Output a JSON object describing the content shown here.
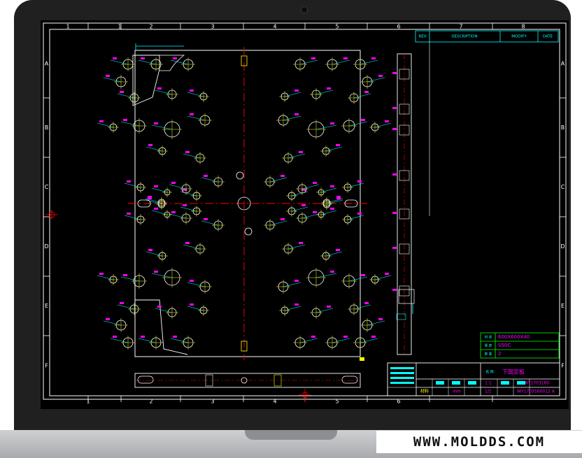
{
  "colors": {
    "screen": "#000000",
    "line": "#ffffff",
    "cyan": "#00ffff",
    "magenta": "#ff00ff",
    "yellow": "#ffff00",
    "red": "#ff0000",
    "green": "#00ff00",
    "laptop_body": "#202020",
    "laptop_base": "#bdbec0"
  },
  "icons": {
    "webcam": "webcam-icon",
    "crosshair": "crosshair-icon"
  },
  "brand": {
    "url": "WWW.MOLDDS.COM"
  },
  "drawing": {
    "column_numbers": [
      "1",
      "1",
      "2",
      "3",
      "4",
      "5",
      "6",
      "7",
      "8"
    ],
    "bottom_column_numbers": [
      "1",
      "2",
      "3",
      "4",
      "5",
      "6"
    ],
    "row_letters": [
      "A",
      "B",
      "C",
      "D",
      "E",
      "F"
    ],
    "revision_headers": [
      "REV",
      "DESCRIPTION",
      "MODIFY",
      "DATE"
    ],
    "specs": [
      "600X600X40",
      "S50C",
      "2"
    ],
    "title_block": {
      "name": "下固定板",
      "part_no": "WY1703160",
      "drawing_no": "WY1703160012 A",
      "scale": "1:1",
      "unit": "mm",
      "sheet": "1/1",
      "material_label": "材料",
      "title_label": "名 称"
    }
  }
}
